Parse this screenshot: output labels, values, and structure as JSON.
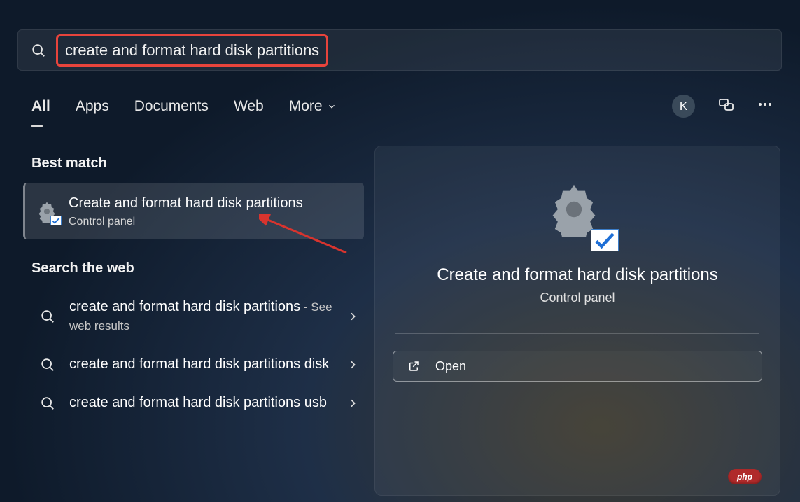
{
  "search": {
    "query": "create and format hard disk partitions"
  },
  "tabs": {
    "all": "All",
    "apps": "Apps",
    "documents": "Documents",
    "web": "Web",
    "more": "More"
  },
  "avatar_letter": "K",
  "sections": {
    "best_match": "Best match",
    "search_web": "Search the web"
  },
  "best_match_result": {
    "title": "Create and format hard disk partitions",
    "subtitle": "Control panel"
  },
  "web_results": [
    {
      "text": "create and format hard disk partitions",
      "suffix": " - See web results"
    },
    {
      "text": "create and format hard disk partitions disk",
      "suffix": ""
    },
    {
      "text": "create and format hard disk partitions usb",
      "suffix": ""
    }
  ],
  "detail": {
    "title": "Create and format hard disk partitions",
    "subtitle": "Control panel",
    "open_label": "Open"
  },
  "badge": "php"
}
